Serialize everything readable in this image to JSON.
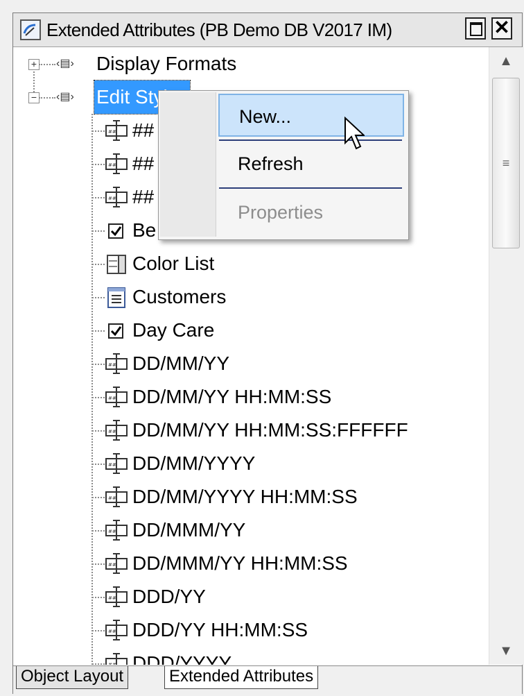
{
  "window": {
    "title": "Extended Attributes (PB Demo DB V2017 IM)",
    "close_glyph": "✕"
  },
  "tree": {
    "nodes": [
      {
        "label": "Display Formats",
        "expander": "+",
        "icon": "folder-icon"
      },
      {
        "label": "Edit Styles",
        "expander": "−",
        "icon": "folder-icon",
        "selected": true
      }
    ],
    "children": [
      {
        "label": "##",
        "icon": "editmask-icon"
      },
      {
        "label": "##",
        "icon": "editmask-icon"
      },
      {
        "label": "##",
        "icon": "editmask-icon"
      },
      {
        "label": "Be",
        "icon": "checkbox-icon"
      },
      {
        "label": "Color List",
        "icon": "dropdown-listbox-icon"
      },
      {
        "label": "Customers",
        "icon": "datawindow-icon"
      },
      {
        "label": "Day Care",
        "icon": "checkbox-icon"
      },
      {
        "label": "DD/MM/YY",
        "icon": "editmask-icon"
      },
      {
        "label": "DD/MM/YY HH:MM:SS",
        "icon": "editmask-icon"
      },
      {
        "label": "DD/MM/YY HH:MM:SS:FFFFFF",
        "icon": "editmask-icon"
      },
      {
        "label": "DD/MM/YYYY",
        "icon": "editmask-icon"
      },
      {
        "label": "DD/MM/YYYY HH:MM:SS",
        "icon": "editmask-icon"
      },
      {
        "label": "DD/MMM/YY",
        "icon": "editmask-icon"
      },
      {
        "label": "DD/MMM/YY HH:MM:SS",
        "icon": "editmask-icon"
      },
      {
        "label": "DDD/YY",
        "icon": "editmask-icon"
      },
      {
        "label": "DDD/YY HH:MM:SS",
        "icon": "editmask-icon"
      },
      {
        "label": "DDD/YYYY",
        "icon": "editmask-icon"
      }
    ]
  },
  "context_menu": {
    "items": [
      {
        "label": "New...",
        "highlighted": true
      },
      {
        "label": "Refresh"
      },
      {
        "label": "Properties",
        "disabled": true
      }
    ]
  },
  "scrollbar": {
    "up_glyph": "▲",
    "down_glyph": "▼",
    "grip_glyph": "≡"
  },
  "tabs": [
    {
      "label": "Object Layout"
    },
    {
      "label": "Extended Attributes",
      "active": true
    }
  ],
  "colors": {
    "selection": "#3399ff",
    "menu_highlight": "#cce4fb",
    "menu_separator": "#2d3f7a"
  }
}
